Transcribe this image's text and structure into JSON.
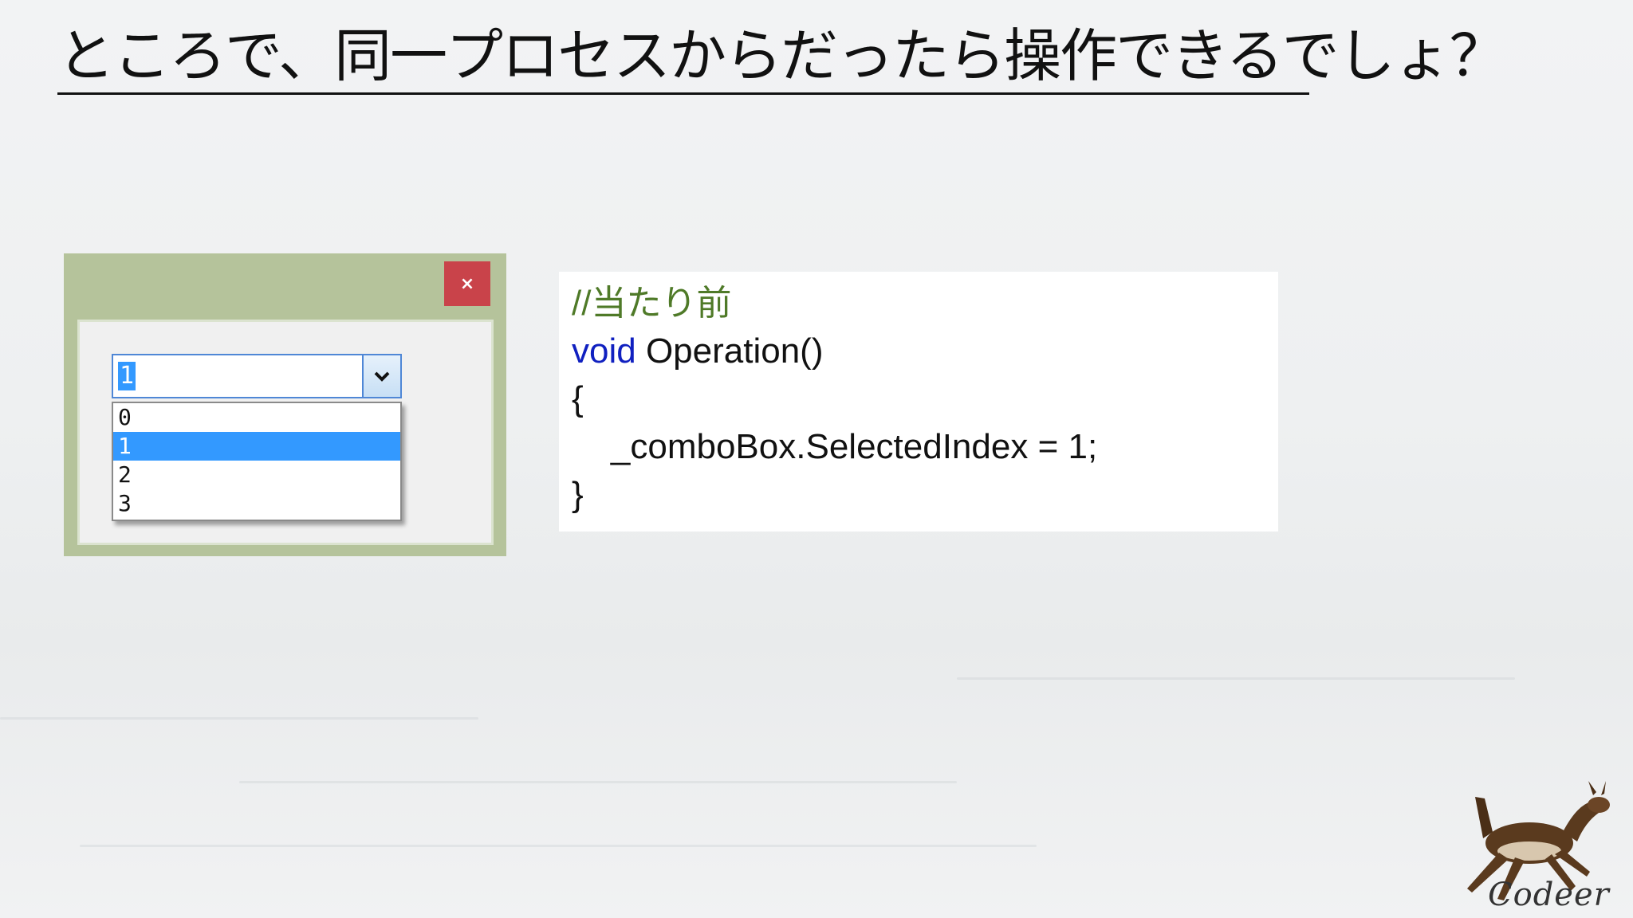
{
  "title": "ところで、同一プロセスからだったら操作できるでしょ？",
  "window": {
    "close_label": "×",
    "combo_value": "1",
    "dropdown_items": [
      "0",
      "1",
      "2",
      "3"
    ],
    "selected_index": 1
  },
  "code": {
    "comment": "//当たり前",
    "keyword": "void",
    "signature": " Operation()",
    "open_brace": "{",
    "statement": "    _comboBox.SelectedIndex = 1;",
    "close_brace": "}"
  },
  "logo": {
    "text": "Codeer"
  },
  "colors": {
    "window_frame": "#b5c39b",
    "close_button": "#c9434a",
    "selection": "#3399ff",
    "comment": "#4f7a28",
    "keyword": "#1020c0"
  }
}
